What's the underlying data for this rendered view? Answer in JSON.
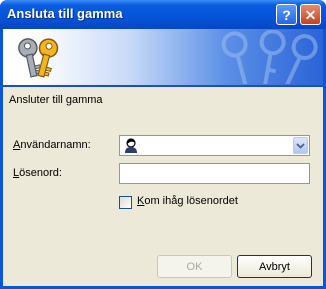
{
  "window": {
    "title": "Ansluta till gamma",
    "help_symbol": "?",
    "close_symbol": "✕"
  },
  "dialog": {
    "heading": "Ansluter till gamma",
    "username_label_first": "A",
    "username_label_rest": "nvändarnamn:",
    "username_value": "",
    "password_label_first": "L",
    "password_label_rest": "ösenord:",
    "password_value": "",
    "remember_label_first": "K",
    "remember_label_rest": "om ihåg lösenordet",
    "remember_checked": false,
    "ok_label": "OK",
    "cancel_label": "Avbryt"
  },
  "icons": {
    "banner": "keys-icon",
    "watermark": "keys-watermark-icon",
    "user": "user-icon",
    "dropdown": "chevron-down-icon"
  },
  "colors": {
    "titlebar": "#0653d8",
    "face": "#ece9d8",
    "border_input": "#7f9db9"
  }
}
